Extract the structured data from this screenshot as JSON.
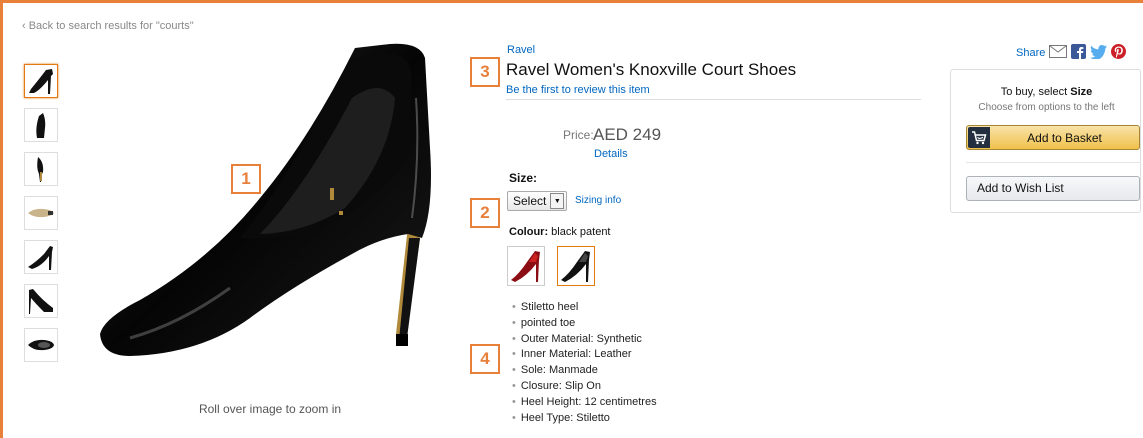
{
  "nav": {
    "back_link": "‹ Back to search results for \"courts\""
  },
  "gallery": {
    "thumbnails": [
      "shoe-side-view",
      "shoe-front-view",
      "shoe-back-view",
      "shoe-sole-view",
      "shoe-side-view-2",
      "shoe-angle-view",
      "shoe-top-view"
    ],
    "selected_index": 0,
    "zoom_hint": "Roll over image to zoom in"
  },
  "annotations": [
    "1",
    "2",
    "3",
    "4"
  ],
  "product": {
    "brand": "Ravel",
    "title": "Ravel Women's Knoxville Court Shoes",
    "review_link": "Be the first to review this item",
    "price_label": "Price:",
    "price": "AED 249",
    "details_link": "Details",
    "size_label": "Size:",
    "size_select": "Select",
    "sizing_info": "Sizing info",
    "colour_label": "Colour:",
    "colour_value": "black patent",
    "swatches": [
      "red-patent",
      "black-patent"
    ],
    "selected_swatch": 1,
    "features": [
      "Stiletto heel",
      "pointed toe",
      "Outer Material: Synthetic",
      "Inner Material: Leather",
      "Sole: Manmade",
      "Closure: Slip On",
      "Heel Height: 12 centimetres",
      "Heel Type: Stiletto"
    ]
  },
  "share": {
    "label": "Share",
    "icons": [
      "email-icon",
      "facebook-icon",
      "twitter-icon",
      "pinterest-icon"
    ]
  },
  "buybox": {
    "prompt_prefix": "To buy, select",
    "prompt_bold": "Size",
    "sub": "Choose from options to the left",
    "add_to_basket": "Add to Basket",
    "add_to_wishlist": "Add to Wish List"
  },
  "colors": {
    "accent": "#e9803a",
    "link": "#0066c0",
    "button_yellow": "#f0c14b"
  }
}
